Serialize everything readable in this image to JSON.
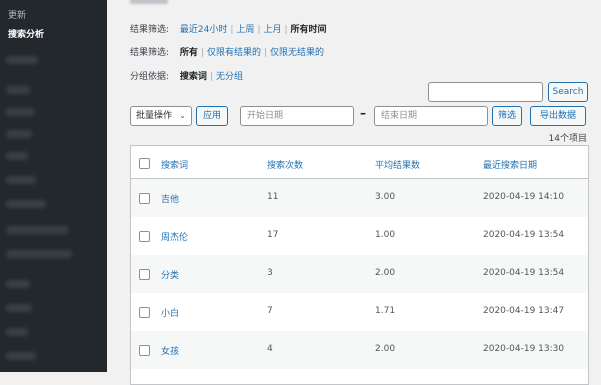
{
  "sidebar": {
    "update_label": "更新",
    "active_label": "搜索分析"
  },
  "filters": {
    "result_label": "结果筛选:",
    "result_options": [
      "最近24小时",
      "上周",
      "上月",
      "所有时间"
    ],
    "result_current": "所有时间",
    "search_label": "结果筛选:",
    "search_options": [
      "所有",
      "仅限有结果的",
      "仅限无结果的"
    ],
    "search_current": "所有",
    "group_label": "分组依据:",
    "group_options": [
      "搜索词",
      "无分组"
    ],
    "group_current": "搜索词"
  },
  "toolbar": {
    "search_button": "Search",
    "bulk_action": "批量操作",
    "apply_button": "应用",
    "start_date_placeholder": "开始日期",
    "end_date_placeholder": "结束日期",
    "filter_button": "筛选",
    "export_button": "导出数据",
    "item_count": "14个项目"
  },
  "table": {
    "columns": [
      "搜索词",
      "搜索次数",
      "平均结果数",
      "最近搜索日期"
    ],
    "rows": [
      {
        "term": "吉他",
        "count": "11",
        "avg": "3.00",
        "date": "2020-04-19 14:10"
      },
      {
        "term": "周杰伦",
        "count": "17",
        "avg": "1.00",
        "date": "2020-04-19 13:54"
      },
      {
        "term": "分类",
        "count": "3",
        "avg": "2.00",
        "date": "2020-04-19 13:54"
      },
      {
        "term": "小白",
        "count": "7",
        "avg": "1.71",
        "date": "2020-04-19 13:47"
      },
      {
        "term": "女孩",
        "count": "4",
        "avg": "2.00",
        "date": "2020-04-19 13:30"
      }
    ]
  },
  "colors": {
    "sidebar_bg": "#23282d",
    "link": "#2271b1",
    "page_bg": "#f1f1f1"
  }
}
